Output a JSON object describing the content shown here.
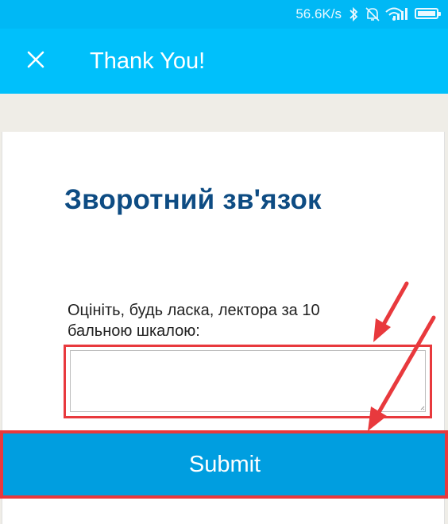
{
  "status_bar": {
    "speed": "56.6K/s",
    "icons": [
      "bluetooth-icon",
      "alarm-off-icon",
      "wifi-icon",
      "signal-icon",
      "battery-icon"
    ]
  },
  "app_bar": {
    "close_icon": "close-icon",
    "title": "Thank You!"
  },
  "form": {
    "heading": "Зворотний зв'язок",
    "question": "Оцініть, будь ласка, лектора за 10 бальною шкалою:",
    "answer_value": "",
    "submit_label": "Submit"
  },
  "annotations": {
    "highlight_color": "#e8393d",
    "items": [
      "textarea-highlight",
      "submit-highlight",
      "arrow-to-textarea",
      "arrow-to-submit"
    ]
  },
  "colors": {
    "app_bar": "#00c0fb",
    "heading": "#0e4c83",
    "submit": "#009ee0"
  }
}
